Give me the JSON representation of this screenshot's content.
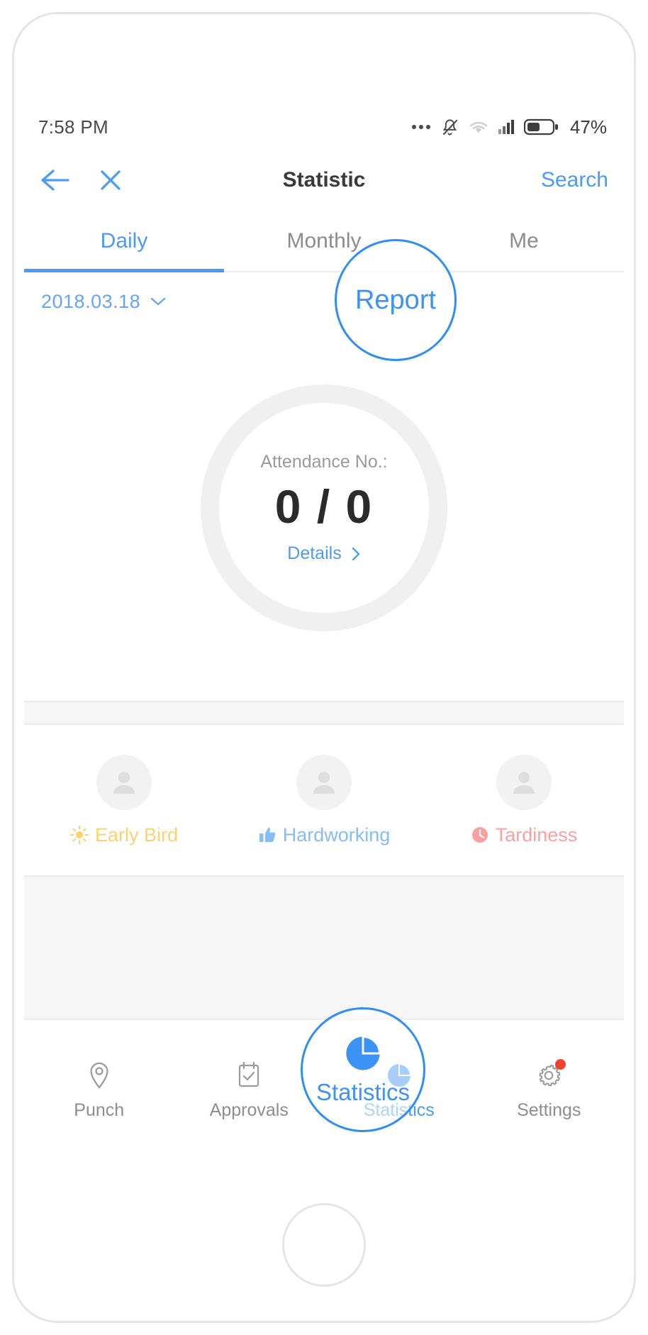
{
  "status_bar": {
    "time": "7:58 PM",
    "icons": [
      "more-dots-icon",
      "mute-bell-icon",
      "wifi-icon",
      "signal-icon",
      "battery-icon"
    ],
    "battery_percent": "47%"
  },
  "header": {
    "back_icon": "arrow-left-icon",
    "close_icon": "close-x-icon",
    "title": "Statistic",
    "search_label": "Search"
  },
  "tabs": [
    {
      "label": "Daily",
      "active": true
    },
    {
      "label": "Monthly",
      "active": false
    },
    {
      "label": "Me",
      "active": false
    }
  ],
  "date_selector": {
    "value": "2018.03.18",
    "chevron_icon": "chevron-down-icon"
  },
  "attendance": {
    "label": "Attendance No.:",
    "count": "0 / 0",
    "details_label": "Details",
    "details_chevron_icon": "chevron-right-icon"
  },
  "badges": [
    {
      "label": "Early Bird",
      "icon": "sun-icon",
      "color": "#fcd271",
      "avatar_icon": "person-avatar-icon"
    },
    {
      "label": "Hardworking",
      "icon": "thumbs-up-icon",
      "color": "#87bdf5",
      "avatar_icon": "person-avatar-icon"
    },
    {
      "label": "Tardiness",
      "icon": "clock-icon",
      "color": "#f9a1a1",
      "avatar_icon": "person-avatar-icon"
    }
  ],
  "bottom_nav": [
    {
      "label": "Punch",
      "icon": "location-pin-icon",
      "active": false,
      "badge": false
    },
    {
      "label": "Approvals",
      "icon": "checklist-icon",
      "active": false,
      "badge": false
    },
    {
      "label": "Statistics",
      "icon": "pie-chart-icon",
      "active": true,
      "badge": false
    },
    {
      "label": "Settings",
      "icon": "gear-icon",
      "active": false,
      "badge": true
    }
  ],
  "annotations": [
    {
      "id": "report",
      "text": "Report"
    },
    {
      "id": "statistics",
      "text": "Statistics"
    }
  ],
  "colors": {
    "accent": "#4a9bf7",
    "annotation": "#2f8ef4",
    "muted": "#8e8e8e",
    "badge_dot": "#f4402f"
  }
}
